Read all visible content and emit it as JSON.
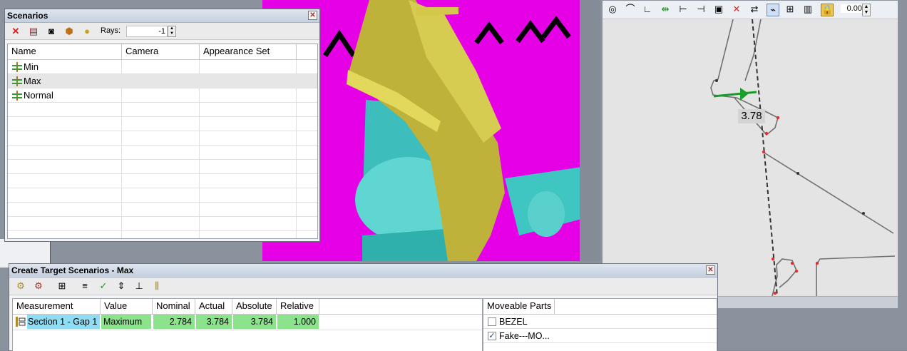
{
  "scenarios_window": {
    "title": "Scenarios",
    "rays_label": "Rays:",
    "rays_value": "-1",
    "columns": [
      "Name",
      "Camera",
      "Appearance Set"
    ],
    "rows": [
      {
        "name": "Min",
        "camera": "",
        "appearance": ""
      },
      {
        "name": "Max",
        "camera": "",
        "appearance": ""
      },
      {
        "name": "Normal",
        "camera": "",
        "appearance": ""
      }
    ],
    "selected_row": "Max"
  },
  "section_view": {
    "toolbar_value": "0.00",
    "measurement_label": "3.78"
  },
  "target_window": {
    "title": "Create Target Scenarios - Max",
    "columns": [
      "Measurement",
      "Value",
      "Nominal",
      "Actual",
      "Absolute",
      "Relative"
    ],
    "row": {
      "measurement": "Section 1 - Gap 1",
      "value": "Maximum",
      "nominal": "2.784",
      "actual": "3.784",
      "absolute": "3.784",
      "relative": "1.000"
    },
    "moveable_header": "Moveable Parts",
    "parts": [
      {
        "label": "BEZEL",
        "checked": false
      },
      {
        "label": "Fake---MO...",
        "checked": true
      }
    ]
  },
  "colors": {
    "magenta": "#e600e6",
    "olive_part": "#c4b83a",
    "teal_part": "#40c7c4",
    "highlight_green": "#8be38b",
    "highlight_cyan": "#8fdcf5"
  }
}
